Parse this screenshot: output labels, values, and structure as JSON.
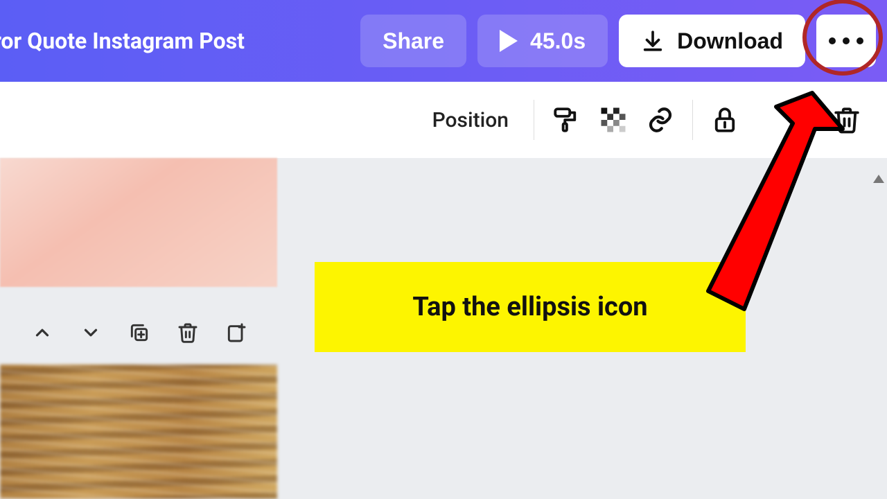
{
  "header": {
    "title": "irror Quote Instagram Post",
    "share_label": "Share",
    "duration": "45.0s",
    "download_label": "Download"
  },
  "contextbar": {
    "position_label": "Position"
  },
  "annotation": {
    "callout": "Tap the ellipsis icon"
  }
}
